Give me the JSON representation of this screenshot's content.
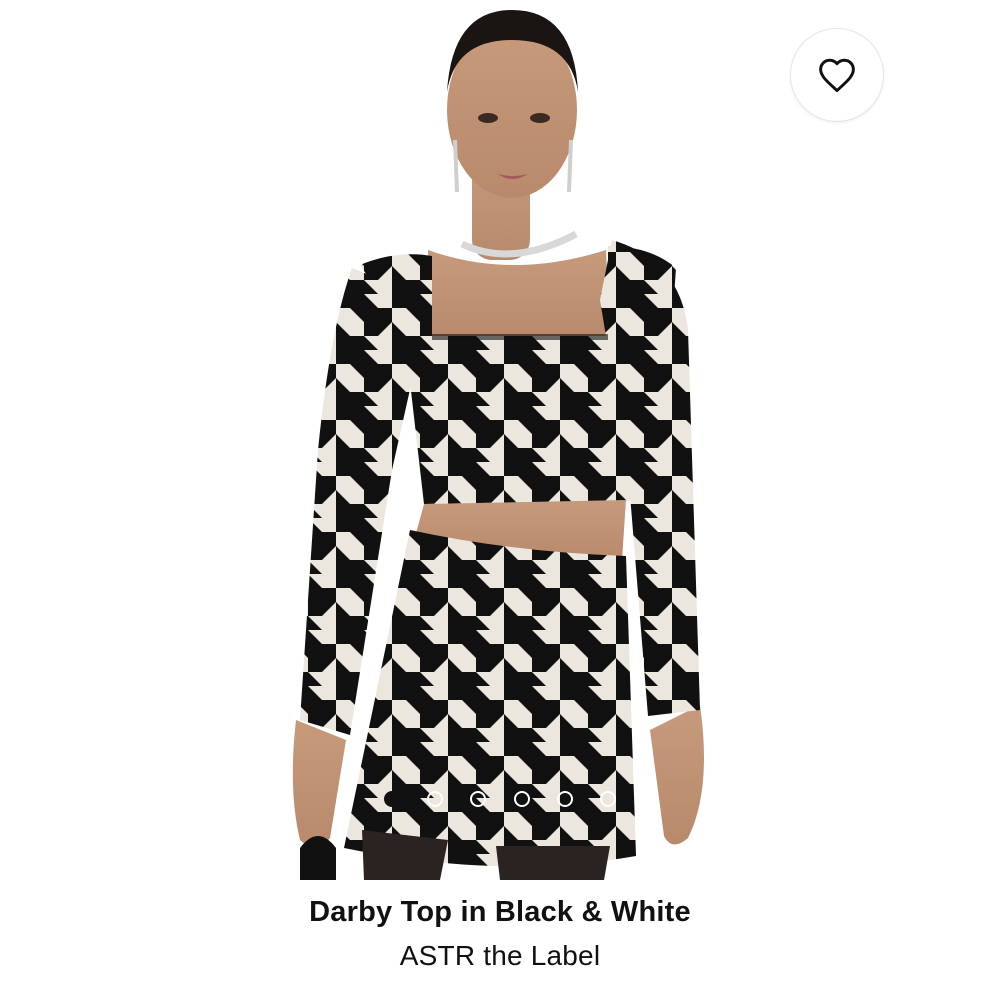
{
  "product": {
    "title": "Darby Top in Black & White",
    "brand": "ASTR the Label",
    "image": {
      "subject": "model wearing houndstooth sequin crop top and mini skirt",
      "pattern_colors": [
        "#111111",
        "#ebe7df"
      ]
    }
  },
  "wishlist": {
    "icon": "heart-outline-icon"
  },
  "carousel": {
    "total": 6,
    "active_index": 0
  },
  "colors": {
    "background": "#ffffff",
    "text": "#111111",
    "dot_active": "#111111",
    "dot_inactive_border": "#ffffff"
  }
}
